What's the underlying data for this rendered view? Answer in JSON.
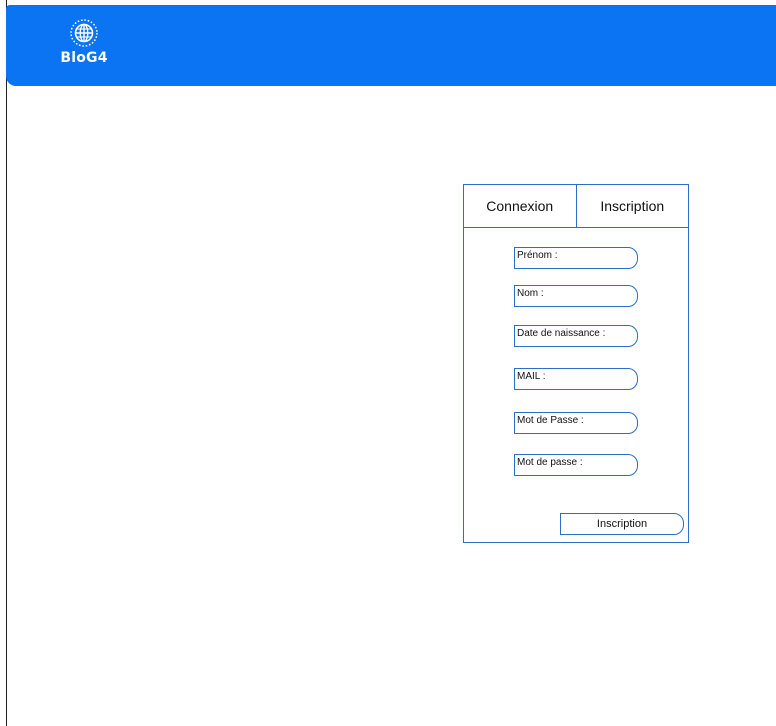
{
  "header": {
    "brand_color": "#0a74f2",
    "logo_icon": "globe-icon",
    "logo_text": "BloG4"
  },
  "auth_panel": {
    "tabs": [
      {
        "label": "Connexion"
      },
      {
        "label": "Inscription"
      }
    ],
    "fields": [
      {
        "label": "Prénom :"
      },
      {
        "label": "Nom :"
      },
      {
        "label": "Date de naissance :"
      },
      {
        "label": "MAIL :"
      },
      {
        "label": "Mot de Passe :"
      },
      {
        "label": "Mot de passe :"
      }
    ],
    "submit_label": "Inscription"
  }
}
